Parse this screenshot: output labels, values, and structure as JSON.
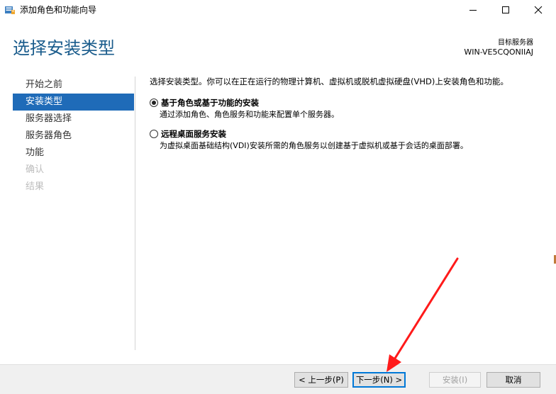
{
  "window": {
    "title": "添加角色和功能向导",
    "icon": "server-manager-icon"
  },
  "header": {
    "page_title": "选择安装类型",
    "target_server_label": "目标服务器",
    "target_server_name": "WIN-VE5CQONIIAJ"
  },
  "nav": {
    "items": [
      {
        "label": "开始之前",
        "state": "normal"
      },
      {
        "label": "安装类型",
        "state": "active"
      },
      {
        "label": "服务器选择",
        "state": "normal"
      },
      {
        "label": "服务器角色",
        "state": "normal"
      },
      {
        "label": "功能",
        "state": "normal"
      },
      {
        "label": "确认",
        "state": "disabled"
      },
      {
        "label": "结果",
        "state": "disabled"
      }
    ]
  },
  "content": {
    "intro": "选择安装类型。你可以在正在运行的物理计算机、虚拟机或脱机虚拟硬盘(VHD)上安装角色和功能。",
    "options": [
      {
        "label": "基于角色或基于功能的安装",
        "description": "通过添加角色、角色服务和功能来配置单个服务器。",
        "checked": true
      },
      {
        "label": "远程桌面服务安装",
        "description": "为虚拟桌面基础结构(VDI)安装所需的角色服务以创建基于虚拟机或基于会话的桌面部署。",
        "checked": false
      }
    ]
  },
  "footer": {
    "prev_label": "< 上一步(P)",
    "next_label": "下一步(N) >",
    "install_label": "安装(I)",
    "cancel_label": "取消"
  },
  "colors": {
    "accent": "#1f6bb8",
    "title_blue": "#1a5c8c",
    "annotation_red": "#ff1a1a"
  }
}
